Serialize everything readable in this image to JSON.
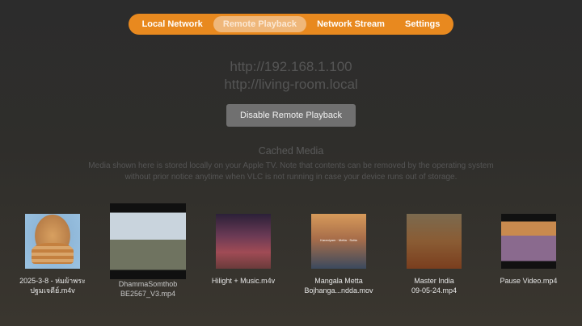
{
  "tabs": [
    {
      "label": "Local Network",
      "active": false
    },
    {
      "label": "Remote Playback",
      "active": true
    },
    {
      "label": "Network Stream",
      "active": false
    },
    {
      "label": "Settings",
      "active": false
    }
  ],
  "remote": {
    "url_ip": "http://192.168.1.100",
    "url_host": "http://living-room.local",
    "disable_button": "Disable Remote Playback"
  },
  "cached": {
    "title": "Cached Media",
    "description": "Media shown here is stored locally on your Apple TV. Note that contents can be removed by the operating system without prior notice anytime when VLC is not running in case your device runs out of storage.",
    "items": [
      {
        "line1": "2025-3-8 - ห่มผ้าพระ",
        "line2": "ปฐมเจดีย์.m4v"
      },
      {
        "line1": "DhammaSomthob",
        "line2": "BE2567_V3.mp4"
      },
      {
        "line1": "Hilight + Music.m4v",
        "line2": ""
      },
      {
        "line1": "Mangala Metta",
        "line2": "Bojhanga...ndda.mov",
        "thumb_text": "Karaniyam · Metta · Sutta"
      },
      {
        "line1": "Master India",
        "line2": "09-05-24.mp4"
      },
      {
        "line1": "Pause Video.mp4",
        "line2": ""
      }
    ]
  }
}
